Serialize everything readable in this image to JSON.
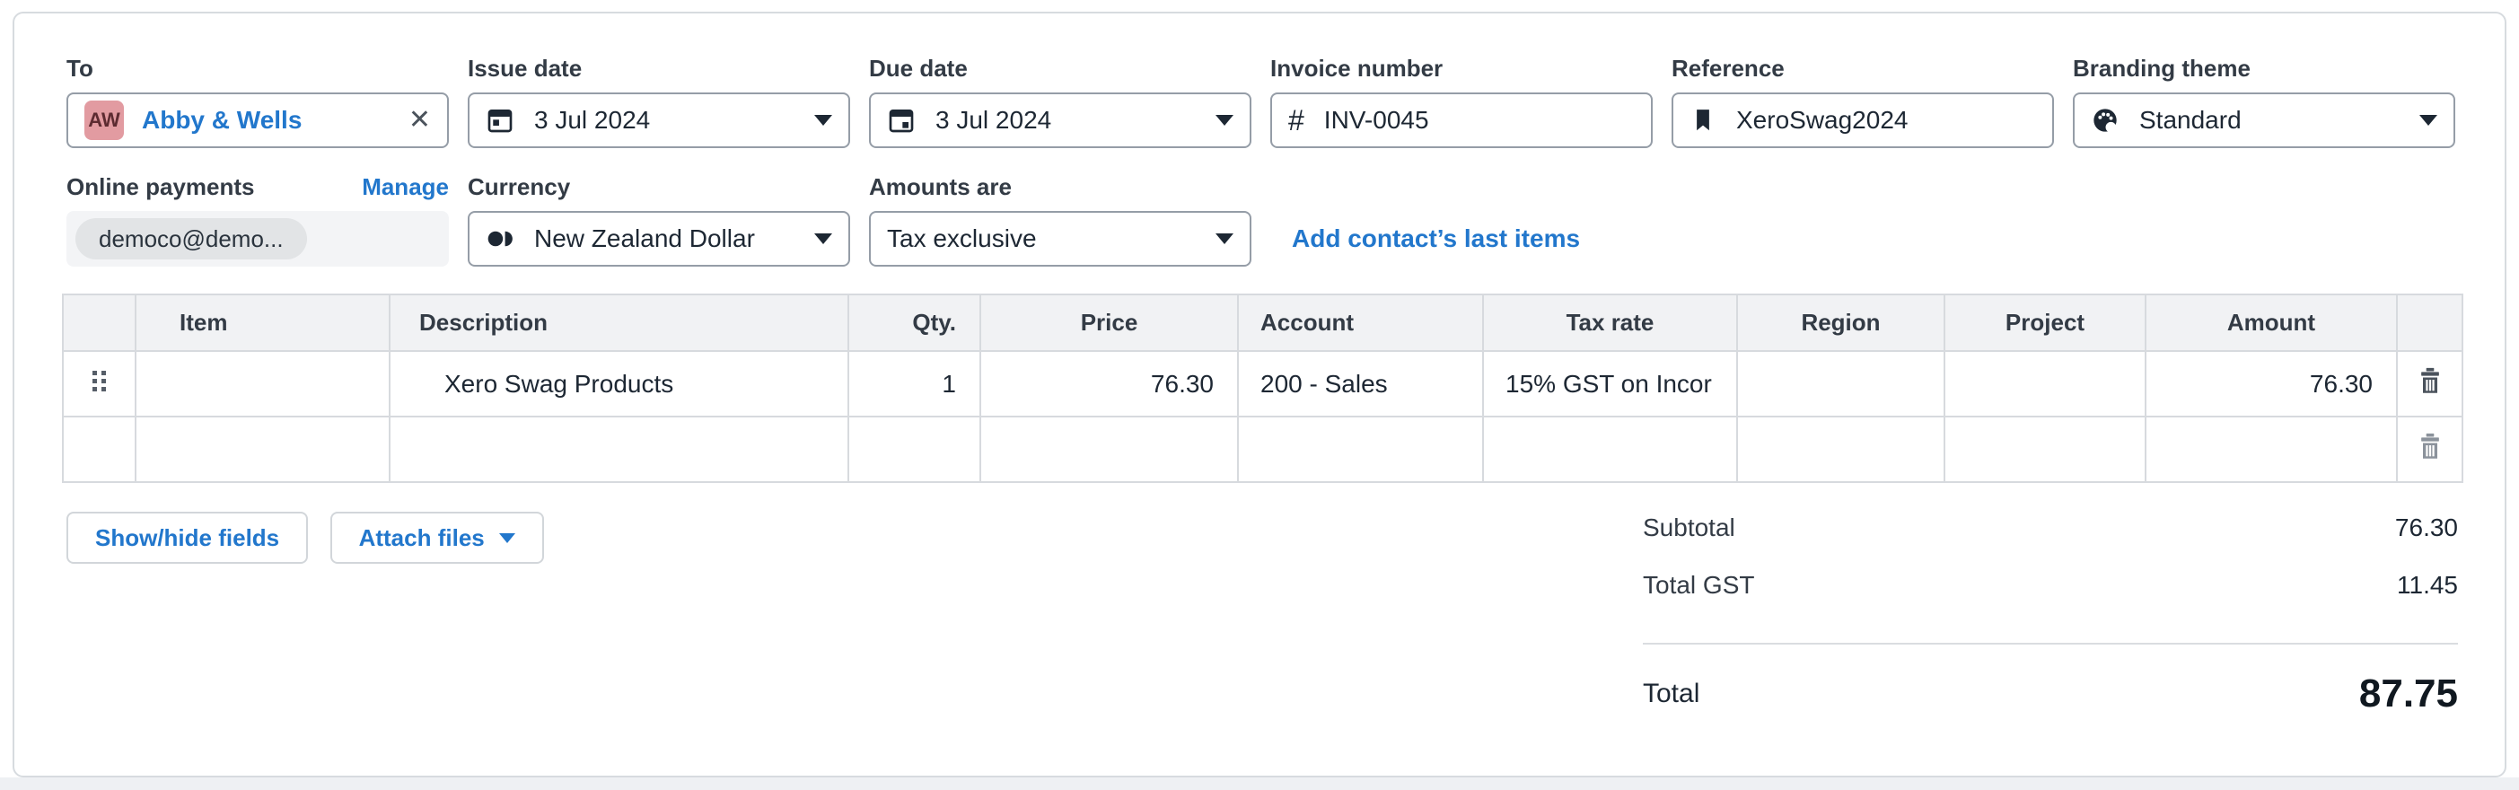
{
  "header_fields": {
    "to": {
      "label": "To",
      "initials": "AW",
      "name": "Abby & Wells",
      "close_icon": "✕"
    },
    "issue_date": {
      "label": "Issue date",
      "value": "3 Jul 2024"
    },
    "due_date": {
      "label": "Due date",
      "value": "3 Jul 2024"
    },
    "invoice_number": {
      "label": "Invoice number",
      "hash": "#",
      "value": "INV-0045"
    },
    "reference": {
      "label": "Reference",
      "value": "XeroSwag2024"
    },
    "branding_theme": {
      "label": "Branding theme",
      "value": "Standard"
    }
  },
  "payments_row": {
    "online_payments_label": "Online payments",
    "manage_label": "Manage",
    "payment_chip": "democo@demo...",
    "currency_label": "Currency",
    "currency_value": "New Zealand Dollar",
    "amounts_label": "Amounts are",
    "amounts_value": "Tax exclusive",
    "add_last_items": "Add contact’s last items"
  },
  "table": {
    "headers": [
      "Item",
      "Description",
      "Qty.",
      "Price",
      "Account",
      "Tax rate",
      "Region",
      "Project",
      "Amount"
    ],
    "rows": [
      {
        "item": "",
        "description": "Xero Swag Products",
        "qty": "1",
        "price": "76.30",
        "account": "200 - Sales",
        "tax_rate": "15% GST on Incor",
        "region": "",
        "project": "",
        "amount": "76.30"
      },
      {
        "item": "",
        "description": "",
        "qty": "",
        "price": "",
        "account": "",
        "tax_rate": "",
        "region": "",
        "project": "",
        "amount": ""
      }
    ]
  },
  "actions": {
    "show_hide_fields": "Show/hide fields",
    "attach_files": "Attach files"
  },
  "totals": {
    "subtotal_label": "Subtotal",
    "subtotal_value": "76.30",
    "gst_label": "Total GST",
    "gst_value": "11.45",
    "total_label": "Total",
    "total_value": "87.75"
  },
  "colors": {
    "accent_blue": "#2277cc",
    "avatar_bg": "#e29ba1",
    "avatar_text": "#5d2b31",
    "text_dark": "#1d2733",
    "label_color": "#333b45",
    "input_border": "#959da7",
    "table_border": "#d7dade",
    "table_header_bg": "#f1f2f4",
    "page_bg": "#eef0f3"
  }
}
